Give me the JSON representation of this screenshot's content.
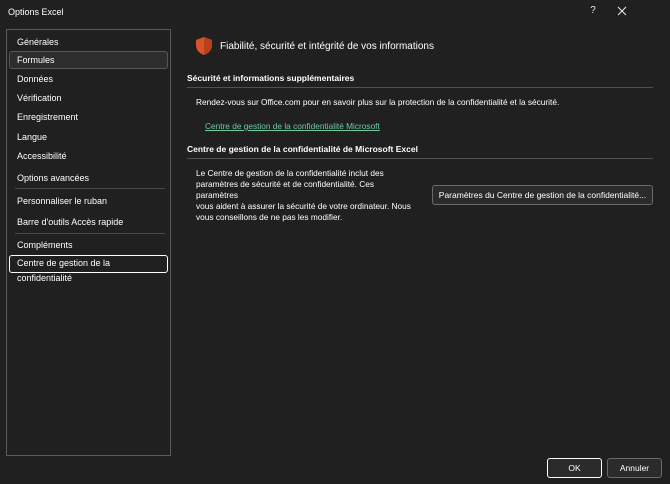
{
  "window": {
    "title": "Options Excel",
    "help_label": "?"
  },
  "sidebar": {
    "items": [
      {
        "label": "Générales"
      },
      {
        "label": "Formules"
      },
      {
        "label": "Données"
      },
      {
        "label": "Vérification"
      },
      {
        "label": "Enregistrement"
      },
      {
        "label": "Langue"
      },
      {
        "label": "Accessibilité"
      },
      {
        "label": "Options avancées"
      },
      {
        "label": "Personnaliser le ruban"
      },
      {
        "label": "Barre d'outils Accès rapide"
      },
      {
        "label": "Compléments"
      },
      {
        "label": "Centre de gestion de la confidentialité"
      }
    ],
    "selected_index": 11,
    "hover_index": 1
  },
  "main": {
    "header": "Fiabilité, sécurité et intégrité de vos informations",
    "section1": {
      "title": "Sécurité et informations supplémentaires",
      "text": "Rendez-vous sur Office.com pour en savoir plus sur la protection de la confidentialité et la sécurité.",
      "link": "Centre de gestion de la confidentialité Microsoft"
    },
    "section2": {
      "title": "Centre de gestion de la confidentialité de Microsoft Excel",
      "line1": "Le Centre de gestion de la confidentialité inclut des",
      "line2": "paramètres de sécurité et de confidentialité. Ces paramètres",
      "line3": "vous aident à assurer la sécurité de votre ordinateur. Nous",
      "line4": "vous conseillons de ne pas les modifier.",
      "button": "Paramètres du Centre de gestion de la confidentialité..."
    }
  },
  "footer": {
    "ok": "OK",
    "cancel": "Annuler"
  },
  "colors": {
    "background": "#202020",
    "link": "#6cc9a0",
    "shield": "#d9532b"
  },
  "icons": {
    "header": "shield-icon",
    "close": "close-icon"
  }
}
